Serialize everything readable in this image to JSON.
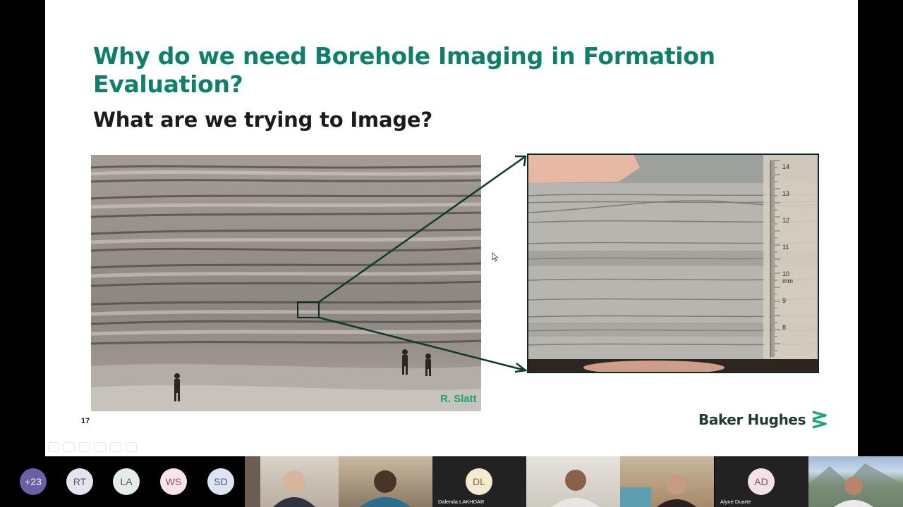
{
  "slide": {
    "title": "Why do we need Borehole Imaging in Formation Evaluation?",
    "subtitle": "What are we trying to Image?",
    "credit": "R. Slatt",
    "slide_number": "17",
    "logo_text": "Baker Hughes",
    "colors": {
      "title": "#0d7f6b",
      "credit": "#1aa37a",
      "logo_mark": "#1aa37a",
      "logo_text": "#1e3a33"
    },
    "core_scale_marks": [
      "14",
      "13",
      "12",
      "11",
      "10 mm",
      "9",
      "8"
    ]
  },
  "participants": {
    "overflow": {
      "label": "+23",
      "color": "#6b5fa8"
    },
    "avatars": [
      {
        "initials": "RT",
        "bg": "#e4e4ee",
        "fg": "#555"
      },
      {
        "initials": "LA",
        "bg": "#e3ece9",
        "fg": "#555"
      },
      {
        "initials": "WS",
        "bg": "#f8e4ec",
        "fg": "#9b4868"
      },
      {
        "initials": "SD",
        "bg": "#dde3f2",
        "fg": "#4a557a"
      }
    ],
    "tiles": [
      {
        "name": "",
        "type": "video"
      },
      {
        "name": "",
        "type": "video"
      },
      {
        "name": "Dalenda LAKHDAR",
        "type": "avatar",
        "initials": "DL",
        "bg": "#f5ead0",
        "fg": "#7a6a3a"
      },
      {
        "name": "",
        "type": "video"
      },
      {
        "name": "",
        "type": "video"
      },
      {
        "name": "Alyne Duarte",
        "type": "avatar",
        "initials": "AD",
        "bg": "#f3e1ea",
        "fg": "#7a4d62"
      },
      {
        "name": "",
        "type": "video"
      }
    ]
  }
}
